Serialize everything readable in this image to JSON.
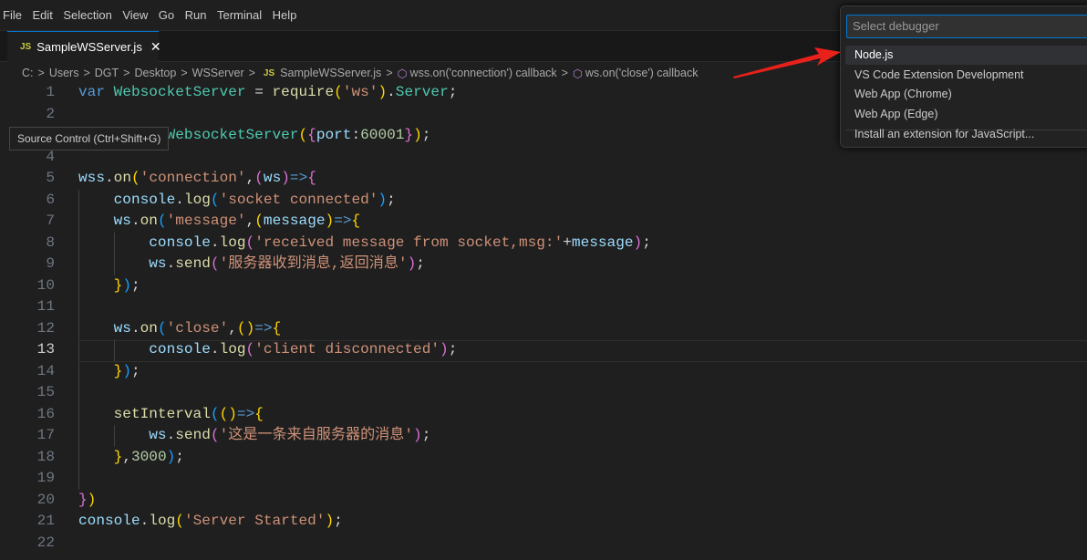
{
  "menu": [
    "File",
    "Edit",
    "Selection",
    "View",
    "Go",
    "Run",
    "Terminal",
    "Help"
  ],
  "tab": {
    "icon": "JS",
    "label": "SampleWSServer.js",
    "close": "✕"
  },
  "breadcrumbs": {
    "parts": [
      "C:",
      "Users",
      "DGT",
      "Desktop",
      "WSServer"
    ],
    "file_icon": "JS",
    "file": "SampleWSServer.js",
    "symbols": [
      "wss.on('connection') callback",
      "ws.on('close') callback"
    ]
  },
  "tooltip": "Source Control (Ctrl+Shift+G)",
  "picker": {
    "placeholder": "Select debugger",
    "options": [
      "Node.js",
      "VS Code Extension Development",
      "Web App (Chrome)",
      "Web App (Edge)",
      "Install an extension for JavaScript..."
    ],
    "selected": 0
  },
  "annotation_color": "#e8211b",
  "cursor_line": 13,
  "lines": [
    [
      [
        "var",
        "k"
      ],
      [
        " ",
        "p"
      ],
      [
        "WebsocketServer",
        "c"
      ],
      [
        " = ",
        "p"
      ],
      [
        "require",
        "f"
      ],
      [
        "(",
        "b1"
      ],
      [
        "'ws'",
        "s"
      ],
      [
        ")",
        "b1"
      ],
      [
        ".",
        "p"
      ],
      [
        "Server",
        "c"
      ],
      [
        ";",
        "p"
      ]
    ],
    [],
    [
      [
        "          ",
        "p"
      ],
      [
        "WebsocketServer",
        "c"
      ],
      [
        "(",
        "b1"
      ],
      [
        "{",
        "b2"
      ],
      [
        "port",
        "v"
      ],
      [
        ":",
        "p"
      ],
      [
        "60001",
        "n"
      ],
      [
        "}",
        "b2"
      ],
      [
        ")",
        "b1"
      ],
      [
        ";",
        "p"
      ]
    ],
    [],
    [
      [
        "wss",
        "v"
      ],
      [
        ".",
        "p"
      ],
      [
        "on",
        "f"
      ],
      [
        "(",
        "b1"
      ],
      [
        "'connection'",
        "s"
      ],
      [
        ",",
        "p"
      ],
      [
        "(",
        "b2"
      ],
      [
        "ws",
        "v"
      ],
      [
        ")",
        "b2"
      ],
      [
        "=>",
        "k"
      ],
      [
        "{",
        "b2"
      ]
    ],
    [
      [
        "    ",
        "p"
      ],
      [
        "console",
        "v"
      ],
      [
        ".",
        "p"
      ],
      [
        "log",
        "f"
      ],
      [
        "(",
        "b3"
      ],
      [
        "'socket connected'",
        "s"
      ],
      [
        ")",
        "b3"
      ],
      [
        ";",
        "p"
      ]
    ],
    [
      [
        "    ",
        "p"
      ],
      [
        "ws",
        "v"
      ],
      [
        ".",
        "p"
      ],
      [
        "on",
        "f"
      ],
      [
        "(",
        "b3"
      ],
      [
        "'message'",
        "s"
      ],
      [
        ",",
        "p"
      ],
      [
        "(",
        "b1"
      ],
      [
        "message",
        "v"
      ],
      [
        ")",
        "b1"
      ],
      [
        "=>",
        "k"
      ],
      [
        "{",
        "b1"
      ]
    ],
    [
      [
        "        ",
        "p"
      ],
      [
        "console",
        "v"
      ],
      [
        ".",
        "p"
      ],
      [
        "log",
        "f"
      ],
      [
        "(",
        "b2"
      ],
      [
        "'received message from socket,msg:'",
        "s"
      ],
      [
        "+",
        "p"
      ],
      [
        "message",
        "v"
      ],
      [
        ")",
        "b2"
      ],
      [
        ";",
        "p"
      ]
    ],
    [
      [
        "        ",
        "p"
      ],
      [
        "ws",
        "v"
      ],
      [
        ".",
        "p"
      ],
      [
        "send",
        "f"
      ],
      [
        "(",
        "b2"
      ],
      [
        "'服务器收到消息,返回消息'",
        "s"
      ],
      [
        ")",
        "b2"
      ],
      [
        ";",
        "p"
      ]
    ],
    [
      [
        "    ",
        "p"
      ],
      [
        "}",
        "b1"
      ],
      [
        ")",
        "b3"
      ],
      [
        ";",
        "p"
      ]
    ],
    [],
    [
      [
        "    ",
        "p"
      ],
      [
        "ws",
        "v"
      ],
      [
        ".",
        "p"
      ],
      [
        "on",
        "f"
      ],
      [
        "(",
        "b3"
      ],
      [
        "'close'",
        "s"
      ],
      [
        ",",
        "p"
      ],
      [
        "(",
        "b1"
      ],
      [
        ")",
        "b1"
      ],
      [
        "=>",
        "k"
      ],
      [
        "{",
        "b1"
      ]
    ],
    [
      [
        "        ",
        "p"
      ],
      [
        "console",
        "v"
      ],
      [
        ".",
        "p"
      ],
      [
        "log",
        "f"
      ],
      [
        "(",
        "b2"
      ],
      [
        "'client disconnected'",
        "s"
      ],
      [
        ")",
        "b2"
      ],
      [
        ";",
        "p"
      ]
    ],
    [
      [
        "    ",
        "p"
      ],
      [
        "}",
        "b1"
      ],
      [
        ")",
        "b3"
      ],
      [
        ";",
        "p"
      ]
    ],
    [],
    [
      [
        "    ",
        "p"
      ],
      [
        "setInterval",
        "f"
      ],
      [
        "(",
        "b3"
      ],
      [
        "(",
        "b1"
      ],
      [
        ")",
        "b1"
      ],
      [
        "=>",
        "k"
      ],
      [
        "{",
        "b1"
      ]
    ],
    [
      [
        "        ",
        "p"
      ],
      [
        "ws",
        "v"
      ],
      [
        ".",
        "p"
      ],
      [
        "send",
        "f"
      ],
      [
        "(",
        "b2"
      ],
      [
        "'这是一条来自服务器的消息'",
        "s"
      ],
      [
        ")",
        "b2"
      ],
      [
        ";",
        "p"
      ]
    ],
    [
      [
        "    ",
        "p"
      ],
      [
        "}",
        "b1"
      ],
      [
        ",",
        "p"
      ],
      [
        "3000",
        "n"
      ],
      [
        ")",
        "b3"
      ],
      [
        ";",
        "p"
      ]
    ],
    [],
    [
      [
        "}",
        "b2"
      ],
      [
        ")",
        "b1"
      ]
    ],
    [
      [
        "console",
        "v"
      ],
      [
        ".",
        "p"
      ],
      [
        "log",
        "f"
      ],
      [
        "(",
        "b1"
      ],
      [
        "'Server Started'",
        "s"
      ],
      [
        ")",
        "b1"
      ],
      [
        ";",
        "p"
      ]
    ],
    []
  ]
}
